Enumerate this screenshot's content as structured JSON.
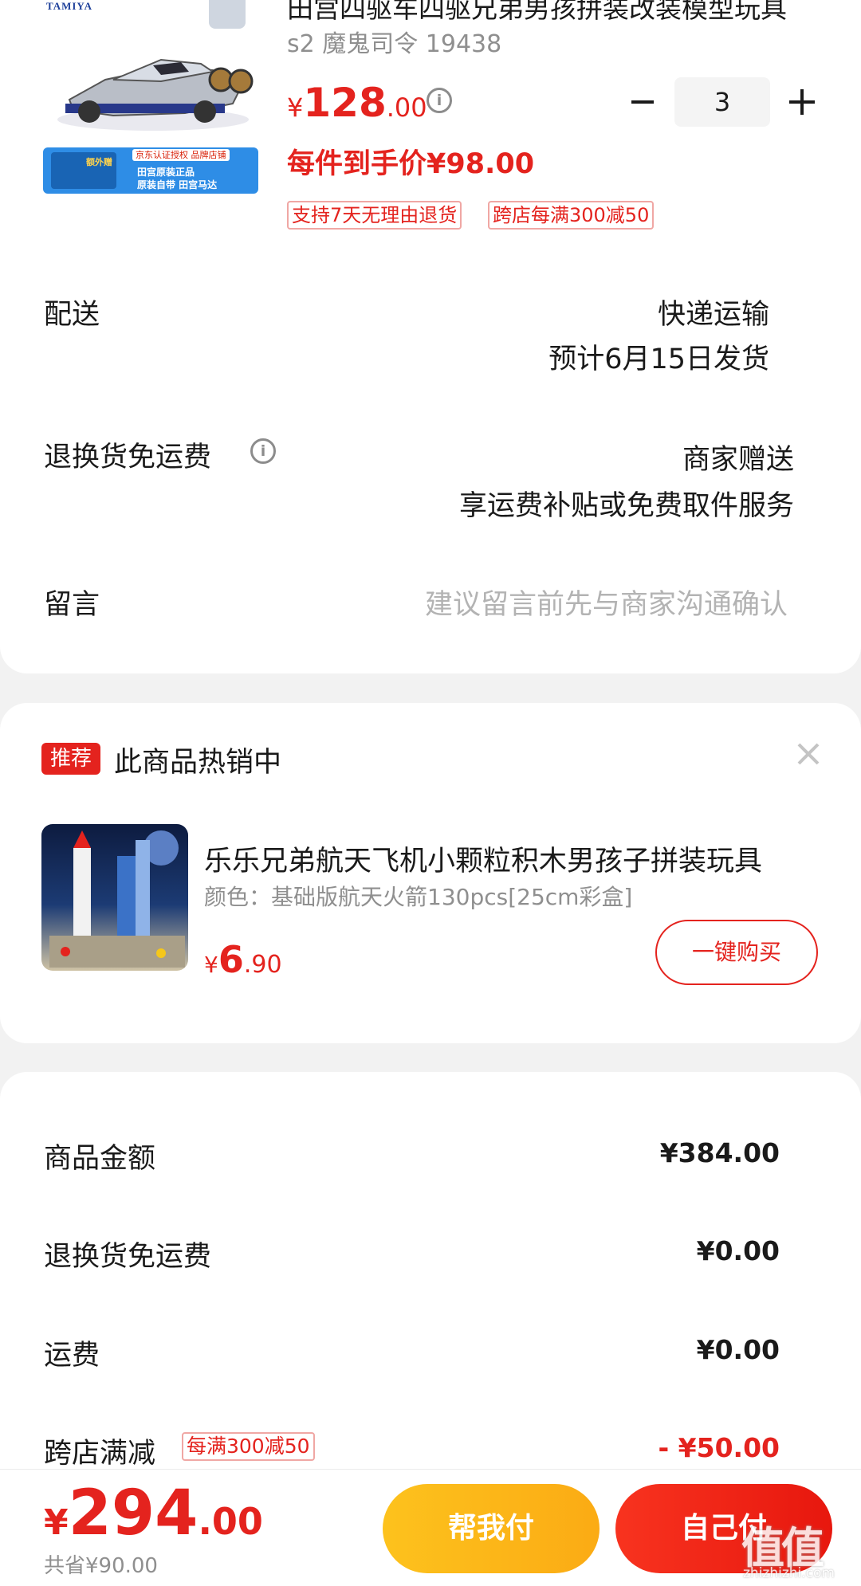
{
  "product": {
    "brand_logo": "TAMIYA",
    "banner": {
      "gift_label": "额外赠",
      "auth_label": "京东认证授权 品牌店铺",
      "line1": "田宫原装正品",
      "line2": "原装自带 田宫马达"
    },
    "title": "田宫四驱车四驱兄弟男孩拼装改装模型玩具",
    "sku": "s2 魔鬼司令 19438",
    "price_currency": "¥",
    "price_int": "128",
    "price_dec": ".00",
    "quantity": "3",
    "final_price": "每件到手价¥98.00",
    "tags": [
      "支持7天无理由退货",
      "跨店每满300减50"
    ]
  },
  "delivery": {
    "label": "配送",
    "method": "快递运输",
    "eta": "预计6月15日发货"
  },
  "return_freight": {
    "label": "退换货免运费",
    "value1": "商家赠送",
    "value2": "享运费补贴或免费取件服务"
  },
  "message": {
    "label": "留言",
    "placeholder": "建议留言前先与商家沟通确认"
  },
  "recommend": {
    "badge": "推荐",
    "title": "此商品热销中",
    "name": "乐乐兄弟航天飞机小颗粒积木男孩子拼装玩具",
    "spec": "颜色：基础版航天火箭130pcs[25cm彩盒]",
    "price_currency": "¥",
    "price_int": "6",
    "price_dec": ".90",
    "buy_label": "一键购买"
  },
  "summary": {
    "rows": [
      {
        "label": "商品金额",
        "value": "¥384.00"
      },
      {
        "label": "退换货免运费",
        "value": "¥0.00"
      },
      {
        "label": "运费",
        "value": "¥0.00"
      },
      {
        "label": "跨店满减",
        "tag": "每满300减50",
        "value": "- ¥50.00"
      }
    ]
  },
  "bottom": {
    "total_currency": "¥",
    "total_int": "294",
    "total_dec": ".00",
    "saved": "共省¥90.00",
    "help_pay": "帮我付",
    "self_pay": "自己付",
    "watermark": "值值值",
    "watermark_url": "zhizhizhi.com"
  },
  "colors": {
    "accent_red": "#e4231e",
    "help_yellow": "#fdc21d",
    "background": "#f2f2f2"
  }
}
